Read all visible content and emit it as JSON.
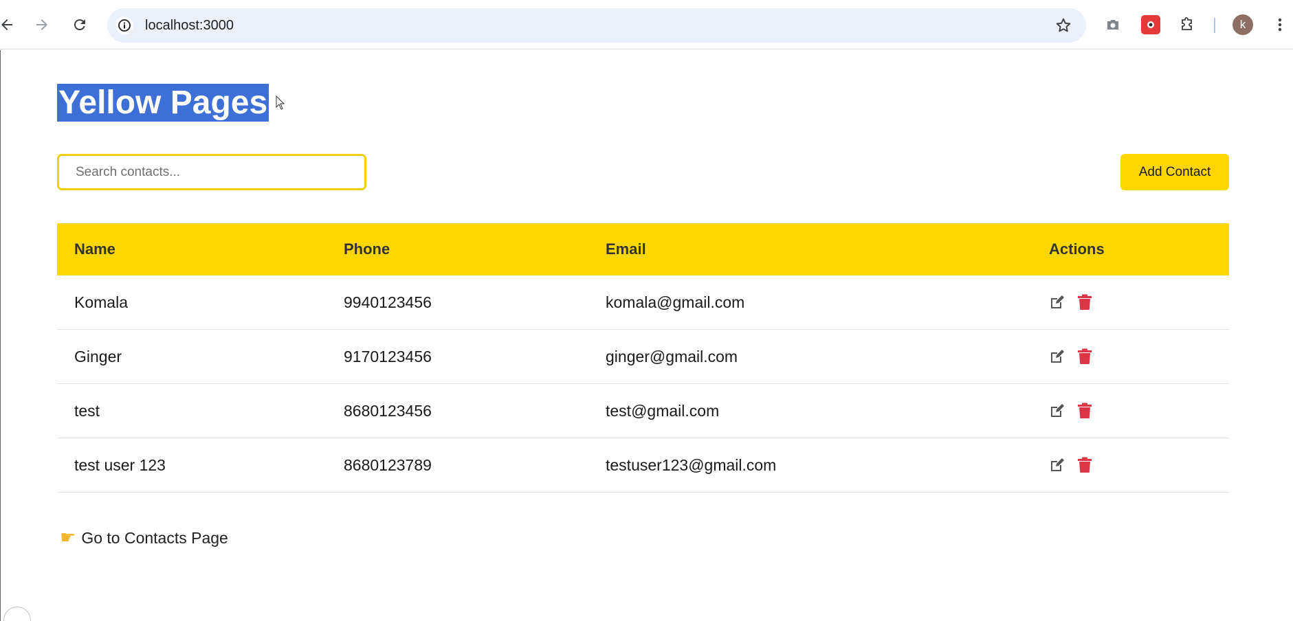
{
  "browser": {
    "url": "localhost:3000",
    "back_icon": "back-arrow-icon",
    "forward_icon": "forward-arrow-icon",
    "reload_icon": "reload-icon",
    "info_icon": "info-icon",
    "bookmark_icon": "star-icon",
    "profile_initial": "k"
  },
  "page": {
    "title": "Yellow Pages",
    "search_placeholder": "Search contacts...",
    "add_button_label": "Add Contact",
    "accent_color": "#ffd700"
  },
  "table": {
    "headers": [
      "Name",
      "Phone",
      "Email",
      "Actions"
    ],
    "rows": [
      {
        "name": "Komala",
        "phone": "9940123456",
        "email": "komala@gmail.com"
      },
      {
        "name": "Ginger",
        "phone": "9170123456",
        "email": "ginger@gmail.com"
      },
      {
        "name": "test",
        "phone": "8680123456",
        "email": "test@gmail.com"
      },
      {
        "name": "test user 123",
        "phone": "8680123789",
        "email": "testuser123@gmail.com"
      }
    ],
    "edit_icon": "edit-icon",
    "delete_icon": "trash-icon",
    "delete_color": "#dc3545"
  },
  "footer_link": {
    "icon": "pointing-hand-icon",
    "label": "Go to Contacts Page"
  }
}
